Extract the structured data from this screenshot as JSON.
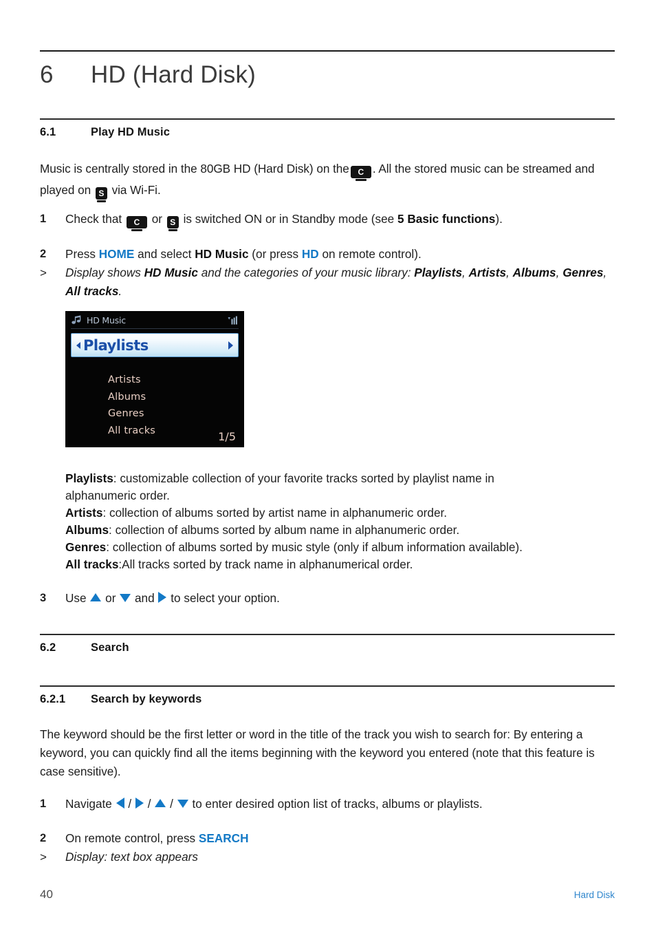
{
  "page": {
    "number": "40",
    "running_head": "Hard Disk"
  },
  "chapter": {
    "number": "6",
    "title": "HD (Hard Disk)"
  },
  "sections": {
    "s61": {
      "number": "6.1",
      "title": "Play HD Music"
    },
    "s62": {
      "number": "6.2",
      "title": "Search"
    },
    "s621": {
      "number": "6.2.1",
      "title": "Search by keywords"
    }
  },
  "intro": {
    "p1_a": "Music is centrally stored in the 80GB HD (Hard Disk) on the",
    "p1_b": ". All the stored music can be streamed and played on",
    "p1_c": "via Wi-Fi."
  },
  "steps_61": [
    {
      "marker": "1",
      "a": "Check that",
      "b": "or",
      "c": "is switched ON or in Standby mode (see",
      "bold": "5 Basic functions",
      "d": ")."
    },
    {
      "marker": "2",
      "a": "Press",
      "key1": "HOME",
      "b": "and select",
      "bold1": "HD Music",
      "c": "(or press",
      "key2": "HD",
      "d": "on remote control)."
    },
    {
      "marker": ">",
      "a": "Display shows",
      "bold1": "HD Music",
      "b": "and the categories of your music library:",
      "bold2": "Playlists",
      "sep1": ",",
      "bold3": "Artists",
      "sep2": ",",
      "bold4": "Albums",
      "sep3": ",",
      "bold5": "Genres",
      "sep4": ",",
      "bold6": "All tracks",
      "sep5": "."
    },
    {
      "marker": "3",
      "a": "Use",
      "b": "or",
      "c": "and",
      "d": "to select your option."
    }
  ],
  "device_screen": {
    "title": "HD Music",
    "note_icon": "music-note-icon",
    "signal_icon": "signal-bars-icon",
    "selected_item": "Playlists",
    "items": [
      "Artists",
      "Albums",
      "Genres",
      "All tracks"
    ],
    "page_indicator": "1/5",
    "colors": {
      "background": "#050505",
      "title_text": "#b9c6d6",
      "item_text": "#e9cfc4",
      "selected_text": "#1b4fa8",
      "selected_border": "#5b9fd6"
    }
  },
  "definitions": [
    {
      "term": "Playlists",
      "sep": ": ",
      "desc_line1": "customizable collection of your favorite tracks sorted by playlist name in",
      "desc_line2": "alphanumeric order."
    },
    {
      "term": "Artists",
      "sep": ": ",
      "desc_line1": "collection of albums sorted by artist name in alphanumeric order.",
      "desc_line2": ""
    },
    {
      "term": "Albums",
      "sep": ": ",
      "desc_line1": "collection of albums sorted by album name in alphanumeric order.",
      "desc_line2": ""
    },
    {
      "term": "Genres",
      "sep": ": ",
      "desc_line1": "collection of albums sorted by music style (only if album information available).",
      "desc_line2": ""
    },
    {
      "term": "All tracks",
      "sep": ":",
      "desc_line1": "All tracks sorted by track name in alphanumerical order.",
      "desc_line2": ""
    }
  ],
  "search": {
    "paragraph": "The keyword should be the first letter or word in the title of the track you wish to search for: By entering a keyword, you can quickly find all the items beginning with the keyword you entered (note that this feature is case sensitive).",
    "steps": [
      {
        "marker": "1",
        "a": "Navigate",
        "sep": "/",
        "b": "to enter desired option list of tracks, albums or playlists."
      },
      {
        "marker": "2",
        "a": "On remote control, press",
        "key": "SEARCH"
      },
      {
        "marker": ">",
        "a": "Display: text box appears"
      }
    ]
  },
  "badges": {
    "center_letter": "C",
    "station_letter": "S"
  },
  "colors": {
    "accent_blue": "#1379c6",
    "running_head_blue": "#2f86cd",
    "text": "#1f1f1f"
  }
}
